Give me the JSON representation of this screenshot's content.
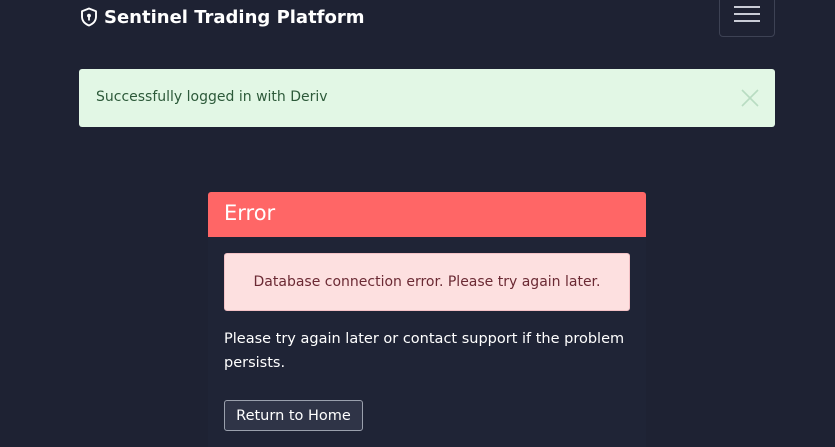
{
  "navbar": {
    "brand_icon": "shield-icon",
    "brand_text": "Sentinel Trading Platform",
    "toggler_icon": "hamburger-menu-icon"
  },
  "success_alert": {
    "message": "Successfully logged in with Deriv",
    "close_icon": "close-icon",
    "color": "#e2f7e5"
  },
  "error_card": {
    "title": "Error",
    "header_color": "#ff6666",
    "alert_message": "Database connection error. Please try again later.",
    "body_text": "Please try again later or contact support if the problem persists.",
    "button_label": "Return to Home"
  }
}
